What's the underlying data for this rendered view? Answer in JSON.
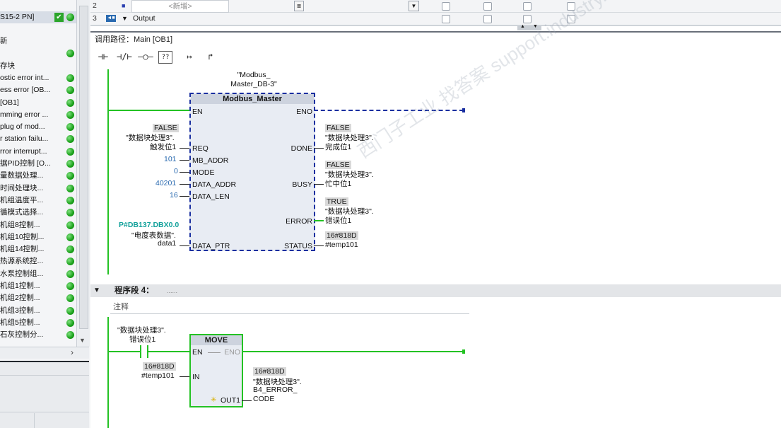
{
  "tree": {
    "header": "S15-2 PN]",
    "items": [
      {
        "label": "新",
        "dot": false
      },
      {
        "label": "",
        "dot": true
      },
      {
        "label": "存块",
        "dot": false
      },
      {
        "label": "ostic error int...",
        "dot": true
      },
      {
        "label": "ess error [OB...",
        "dot": true
      },
      {
        "label": "[OB1]",
        "dot": true
      },
      {
        "label": "mming error ...",
        "dot": true
      },
      {
        "label": "plug of mod...",
        "dot": true
      },
      {
        "label": "r station failu...",
        "dot": true
      },
      {
        "label": "rror interrupt...",
        "dot": true
      },
      {
        "label": "据PID控制 [O...",
        "dot": true
      },
      {
        "label": "量数据处理...",
        "dot": true
      },
      {
        "label": "时间处理块...",
        "dot": true
      },
      {
        "label": "机组温度平...",
        "dot": true
      },
      {
        "label": "循模式选择...",
        "dot": true
      },
      {
        "label": "机组8控制...",
        "dot": true
      },
      {
        "label": "机组10控制...",
        "dot": true
      },
      {
        "label": "机组14控制...",
        "dot": true
      },
      {
        "label": "热源系统控...",
        "dot": true
      },
      {
        "label": "水泵控制组...",
        "dot": true
      },
      {
        "label": "机组1控制...",
        "dot": true
      },
      {
        "label": "机组2控制...",
        "dot": true
      },
      {
        "label": "机组3控制...",
        "dot": true
      },
      {
        "label": "机组5控制...",
        "dot": true
      },
      {
        "label": "石灰控制分...",
        "dot": true
      }
    ]
  },
  "table": {
    "rows": [
      {
        "num": "2",
        "name": "<新增>",
        "icon": "■"
      },
      {
        "num": "3",
        "name": "Output",
        "icon": "▼"
      }
    ]
  },
  "call_path": "调用路径：Main [OB1]",
  "toolbar": [
    "⊣⊢",
    "⊣/⊢",
    "–○–",
    "??",
    "↦",
    "↱"
  ],
  "network3": {
    "instance": "\"Modbus_\nMaster_DB-3\"",
    "block_name": "Modbus_Master",
    "inputs": [
      "EN",
      "REQ",
      "MB_ADDR",
      "MODE",
      "DATA_ADDR",
      "DATA_LEN",
      "DATA_PTR"
    ],
    "outputs": [
      "ENO",
      "DONE",
      "BUSY",
      "ERROR",
      "STATUS"
    ],
    "req_value": "FALSE",
    "req_tag_1": "\"数据块处理3\".",
    "req_tag_2": "触发位1",
    "mb_addr": "101",
    "mode": "0",
    "data_addr": "40201",
    "data_len": "16",
    "ptr_value": "P#DB137.DBX0.0",
    "ptr_tag_1": "\"电度表数据\".",
    "ptr_tag_2": "data1",
    "done_value": "FALSE",
    "done_tag_1": "\"数据块处理3\".",
    "done_tag_2": "完成位1",
    "busy_value": "FALSE",
    "busy_tag_1": "\"数据块处理3\".",
    "busy_tag_2": "忙中位1",
    "error_value": "TRUE",
    "error_tag_1": "\"数据块处理3\".",
    "error_tag_2": "错误位1",
    "status_value": "16#818D",
    "status_tag": "#temp101"
  },
  "network4": {
    "title": "程序段 4：",
    "dots": "......",
    "comment": "注释",
    "contact_tag_1": "\"数据块处理3\".",
    "contact_tag_2": "错误位1",
    "block_name": "MOVE",
    "en": "EN",
    "eno": "ENO",
    "in": "IN",
    "out": "OUT1",
    "in_value": "16#818D",
    "in_tag": "#temp101",
    "out_value": "16#818D",
    "out_tag_1": "\"数据块处理3\".",
    "out_tag_2": "B4_ERROR_",
    "out_tag_3": "CODE"
  },
  "watermark": "西门子工业  找答案  support.industry.siemens.com/cs",
  "colors": {
    "rail": "#24c224",
    "block_border": "#1a2fa0",
    "value_blue": "#2a6ab0",
    "pointer_teal": "#13a19b",
    "status_dot": "#1aa11a"
  }
}
